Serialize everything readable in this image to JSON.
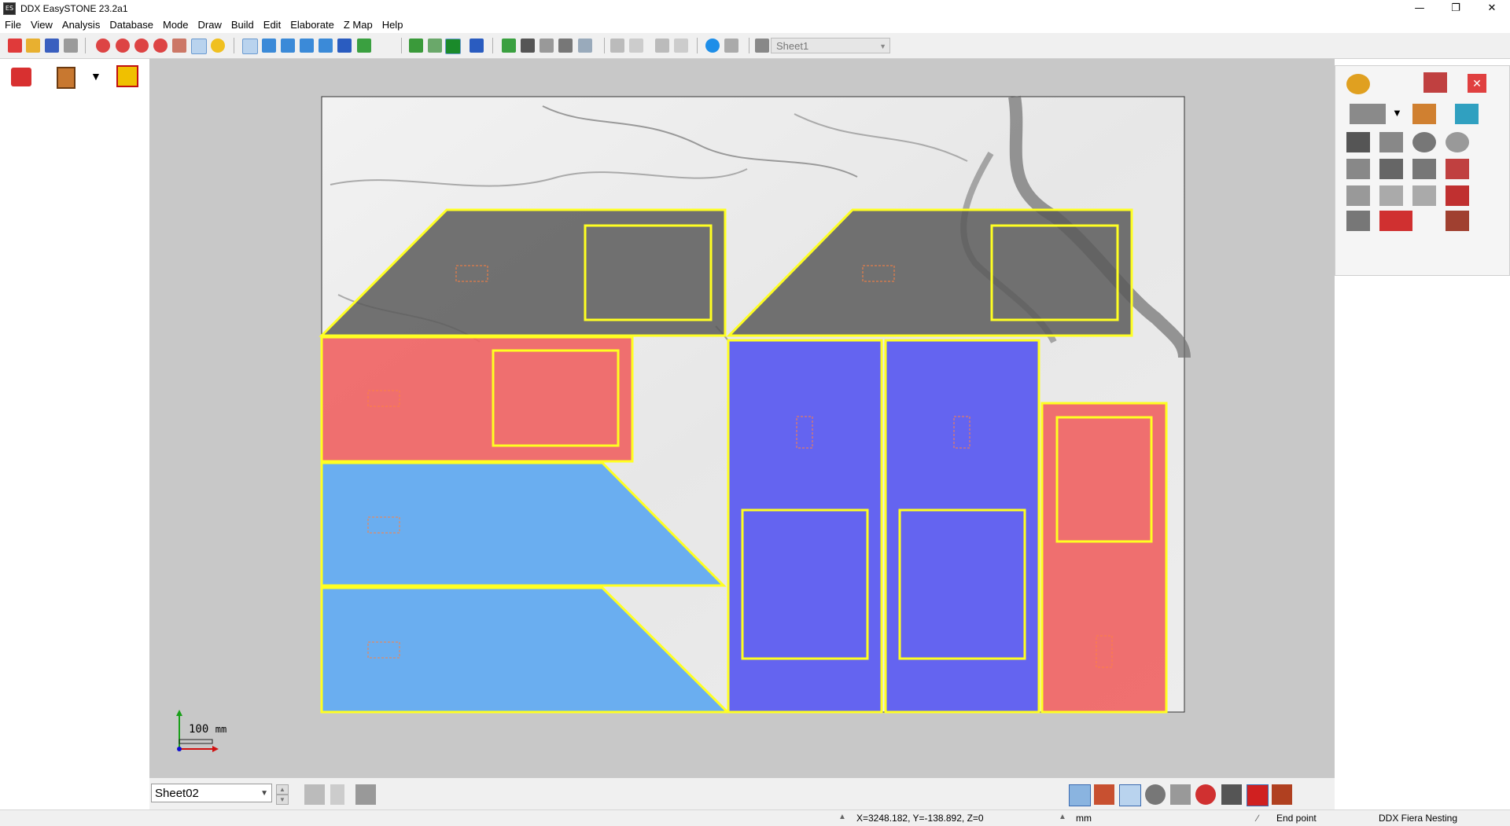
{
  "window": {
    "title": "DDX EasySTONE 23.2a1",
    "app_icon_text": "ES",
    "minimize_icon": "minimize-icon",
    "maximize_icon": "restore-icon",
    "close_icon": "close-icon"
  },
  "menu": [
    "File",
    "View",
    "Analysis",
    "Database",
    "Mode",
    "Draw",
    "Build",
    "Edit",
    "Elaborate",
    "Z Map",
    "Help"
  ],
  "toolbar": {
    "sheet_select": "Sheet1"
  },
  "left_panel": {
    "icons": [
      "layers-list-icon",
      "book-icon",
      "dropdown-arrow-icon",
      "folders-icon"
    ]
  },
  "canvas": {
    "slab_texture": "white-marble",
    "scale_value": "100",
    "scale_unit": "mm",
    "piece_colors": {
      "dark": "#5a5a5a",
      "red": "#ef6262",
      "light_blue": "#6aaef0",
      "blue": "#6464f0",
      "outline": "#ffff22"
    }
  },
  "right_panel": {
    "icons": [
      "settings-gears-icon",
      "report-export-icon",
      "close-panel-icon",
      "slabs-stack-icon",
      "dropdown-arrow-icon",
      "paint-bucket-icon",
      "water-drop-icon",
      "scatter-pieces-icon",
      "explode-icon",
      "rotate-icon",
      "rotate-circle-icon",
      "single-slab-icon",
      "grid-slabs-icon",
      "cut-slab-icon",
      "sawing-machine-icon",
      "piece-shape-icon",
      "puzzle-piece-icon",
      "puzzle-alt-icon",
      "vacuum-cup-icon",
      "nesting-group-icon",
      "move-to-grid-icon",
      "stack-down-icon"
    ]
  },
  "bottom": {
    "sheet_combo": "Sheet02",
    "icons": [
      "spin-up-icon",
      "spin-down-icon",
      "grid-icon",
      "sort-icon",
      "align-icon",
      "nest-active-icon",
      "frame-icon",
      "no-entry-icon",
      "move-icon",
      "cursor-icon",
      "arrows-icon",
      "fit-icon",
      "magnet-icon",
      "window-icon"
    ]
  },
  "status": {
    "coords": "X=3248.182, Y=-138.892, Z=0",
    "unit": "mm",
    "snap": "End point",
    "module": "DDX Fiera Nesting"
  }
}
